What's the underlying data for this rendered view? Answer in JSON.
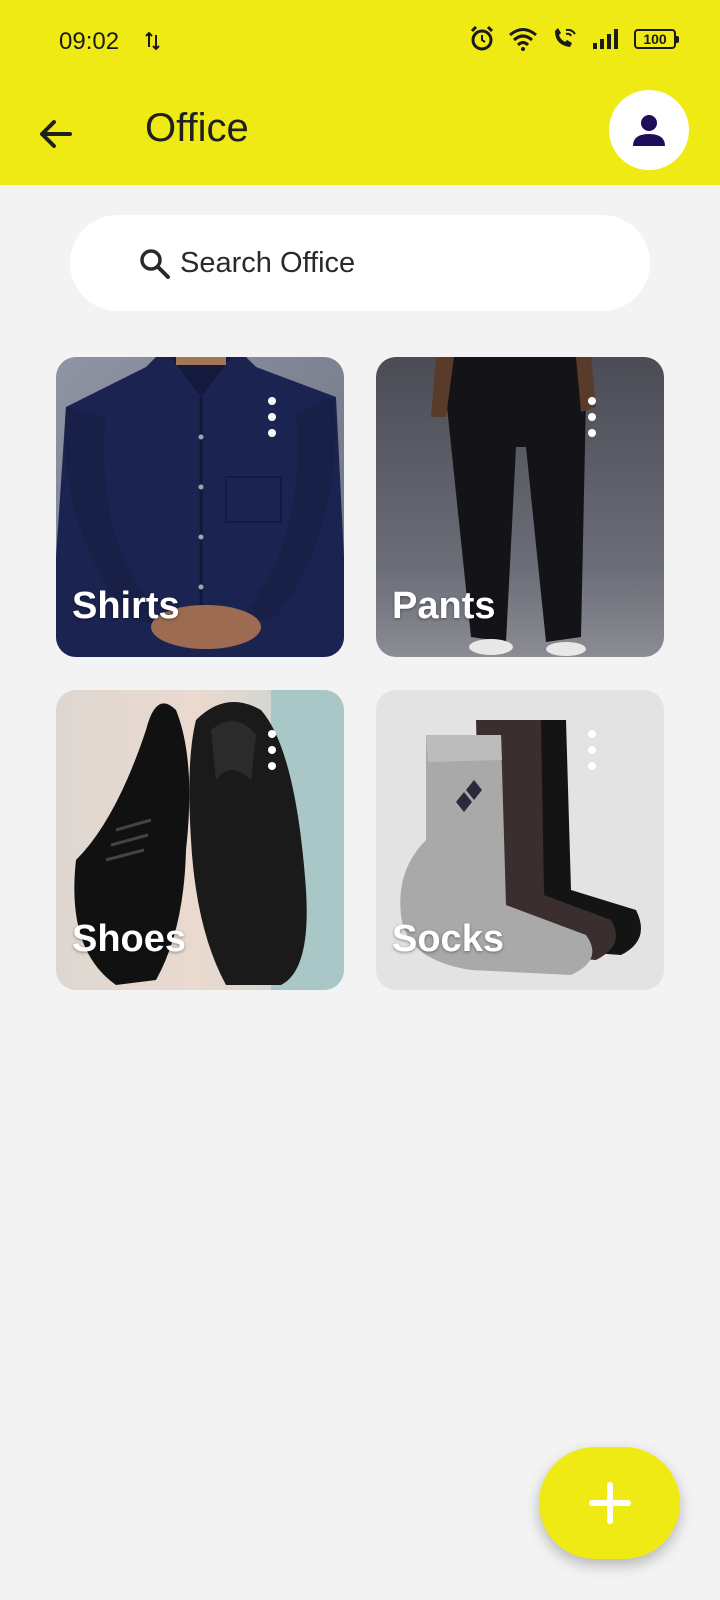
{
  "status_bar": {
    "time": "09:02",
    "battery": "100",
    "icons": [
      "data-sync-icon",
      "alarm-icon",
      "wifi-icon",
      "wifi-calling-icon",
      "signal-icon",
      "battery-icon"
    ]
  },
  "app_bar": {
    "title": "Office",
    "back_icon": "arrow-left-icon",
    "profile_icon": "person-icon",
    "background": "#f0ea14"
  },
  "search": {
    "label": "Search Office",
    "icon": "search-icon"
  },
  "categories": [
    {
      "label": "Shirts",
      "image": "navy dress shirt"
    },
    {
      "label": "Pants",
      "image": "black trousers"
    },
    {
      "label": "Shoes",
      "image": "black leather shoes"
    },
    {
      "label": "Socks",
      "image": "grey and dark socks"
    }
  ],
  "fab": {
    "icon": "plus-icon",
    "color": "#f0ea14"
  }
}
